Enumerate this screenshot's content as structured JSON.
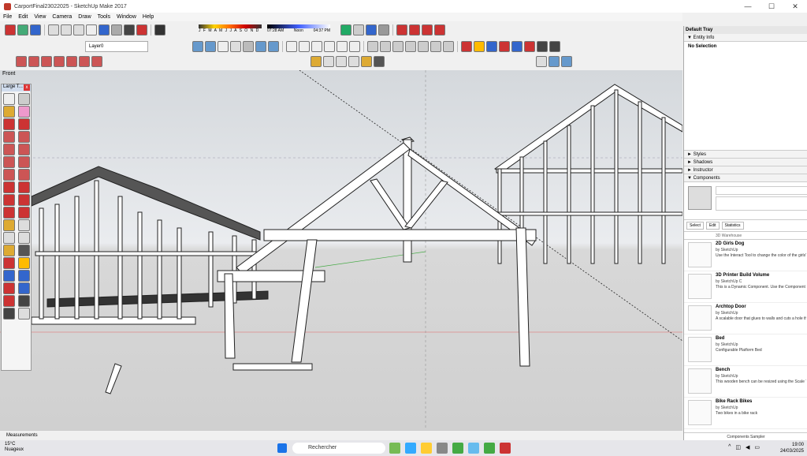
{
  "window": {
    "title": "CarportFinal23022025 - SketchUp Make 2017",
    "min": "—",
    "max": "☐",
    "close": "✕"
  },
  "menu": [
    "File",
    "Edit",
    "View",
    "Camera",
    "Draw",
    "Tools",
    "Window",
    "Help"
  ],
  "shadow": {
    "months": "J F M A M J J A S O N D",
    "time_start": "07:28 AM",
    "time_noon": "Noon",
    "time_end": "04:37 PM"
  },
  "layer": {
    "current": "Layer0"
  },
  "viewport": {
    "scene": "Front"
  },
  "tool_palette": {
    "title": "Large T...",
    "close": "x"
  },
  "status": {
    "measurements": "Measurements"
  },
  "tray": {
    "title": "Default Tray",
    "entity_info": "Entity Info",
    "no_selection": "No Selection",
    "sections": [
      "Styles",
      "Shadows",
      "Instructor",
      "Components"
    ],
    "tabs": [
      "Select",
      "Edit",
      "Statistics"
    ],
    "search_placeholder": "3D Warehouse",
    "components": [
      {
        "name": "2D Girls Dog",
        "by": "by SketchUp",
        "desc": "Use the Interact Tool to change the color of the girls' clothes and the dog's fur."
      },
      {
        "name": "3D Printer Build Volume",
        "by": "by SketchUp C",
        "desc": "This is a Dynamic Component. Use the Component Options window to set the size to..."
      },
      {
        "name": "Archtop Door",
        "by": "by SketchUp",
        "desc": "A scalable door that glues to walls and cuts a hole through them."
      },
      {
        "name": "Bed",
        "by": "by SketchUp",
        "desc": "Configurable Platform Bed"
      },
      {
        "name": "Bench",
        "by": "by SketchUp",
        "desc": "This wooden bench can be resized using the Scale Tool."
      },
      {
        "name": "Bike Rack Bikes",
        "by": "by SketchUp",
        "desc": "Two bikes in a bike rack"
      }
    ],
    "footer": "Components Sampler"
  },
  "taskbar": {
    "temp": "15°C",
    "weather": "Nuageux",
    "search": "Rechercher",
    "time": "19:00",
    "date": "24/03/2025"
  }
}
